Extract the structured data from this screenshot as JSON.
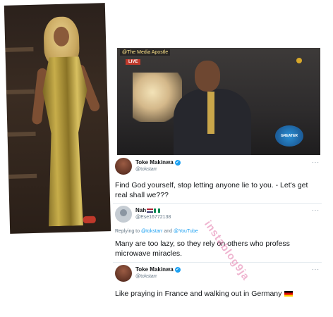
{
  "photo": {
    "alt_subject": "woman-in-gold-dress"
  },
  "video": {
    "overlay_tag": "@The Media Apostle",
    "live_label": "LIVE",
    "channel_logo": "GREATER WORKS"
  },
  "tweets": [
    {
      "name": "Toke Makinwa",
      "handle": "@tokstarr",
      "verified": true,
      "text": "Find God yourself, stop letting anyone lie to you. - Let's get real shall we???"
    },
    {
      "name": "Nah",
      "handle": "@Ese16772138",
      "reply_prefix": "Replying to",
      "reply_to_1": "@tokstarr",
      "reply_and": "and",
      "reply_to_2": "@YouTube",
      "text": "Many are too lazy, so they rely on others who profess microwave miracles."
    },
    {
      "name": "Toke Makinwa",
      "handle": "@tokstarr",
      "verified": true,
      "text": "Like praying in France and walking out in Germany"
    }
  ],
  "more_label": "···",
  "watermark": "instablog9ja",
  "colors": {
    "verified_blue": "#1da1f2",
    "text_primary": "#14171a",
    "text_secondary": "#657786"
  }
}
